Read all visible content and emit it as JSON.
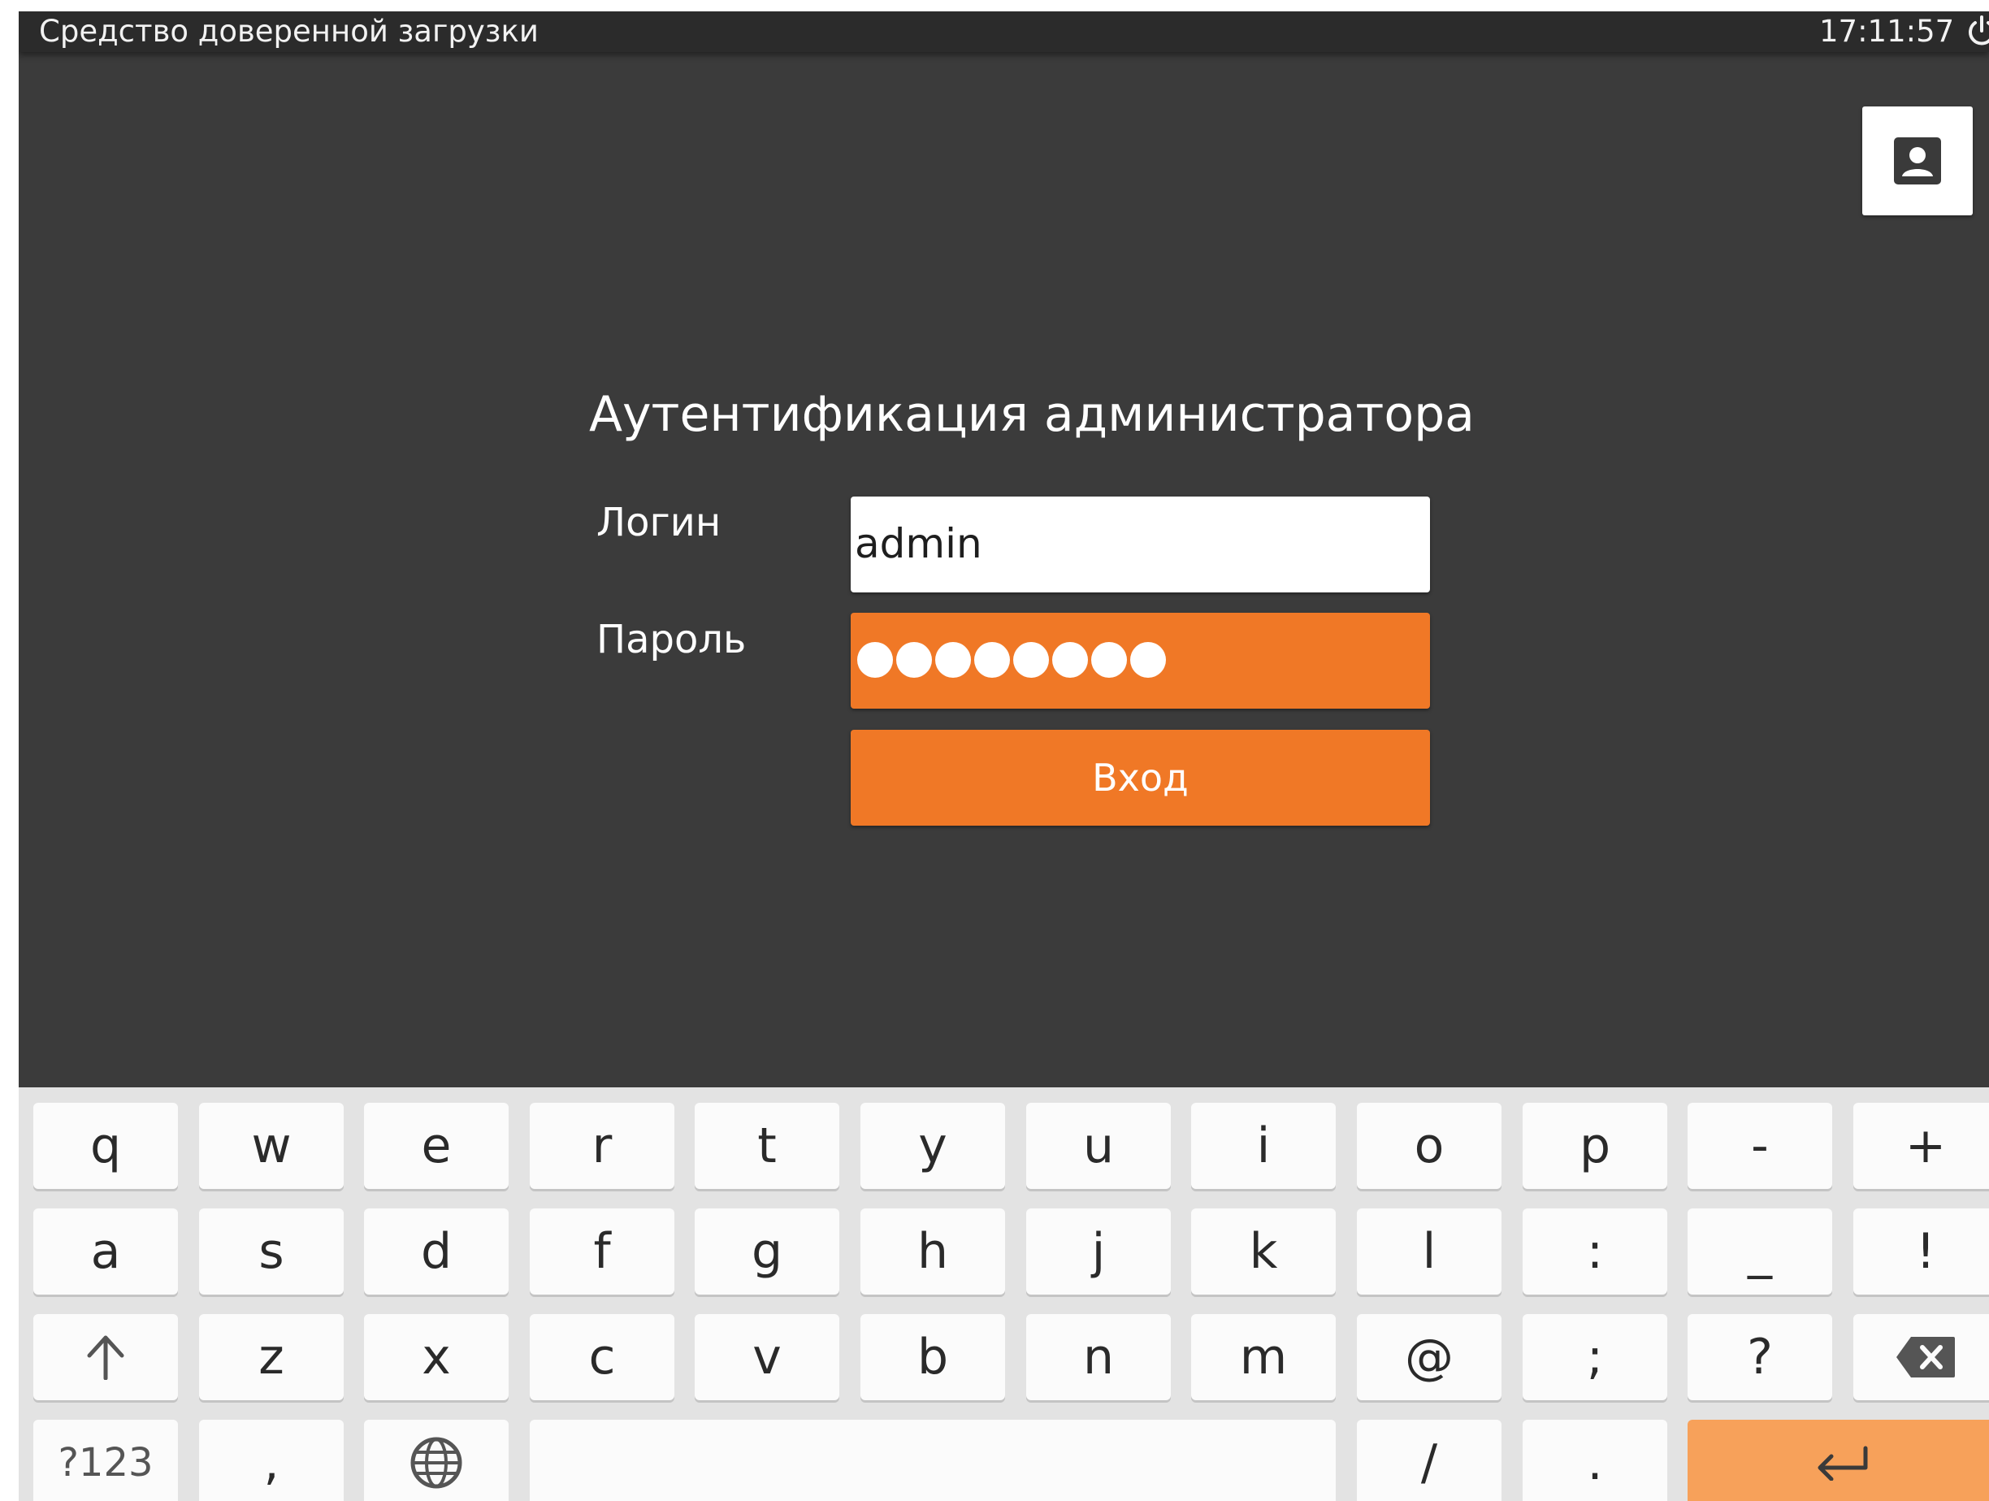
{
  "statusbar": {
    "title": "Средство доверенной загрузки",
    "time": "17:11:57",
    "power_icon": "power-icon"
  },
  "header": {
    "user_icon": "user-account-icon"
  },
  "auth": {
    "title": "Аутентификация администратора",
    "login_label": "Логин",
    "login_value": "admin",
    "password_label": "Пароль",
    "password_dots": 8,
    "submit_label": "Вход",
    "accent_color": "#f07826"
  },
  "keyboard": {
    "rows": [
      [
        "q",
        "w",
        "e",
        "r",
        "t",
        "y",
        "u",
        "i",
        "o",
        "p",
        "-",
        "+"
      ],
      [
        "a",
        "s",
        "d",
        "f",
        "g",
        "h",
        "j",
        "k",
        "l",
        ":",
        "_",
        "!"
      ],
      [
        "shift-icon",
        "z",
        "x",
        "c",
        "v",
        "b",
        "n",
        "m",
        "@",
        ";",
        "?",
        "backspace-icon"
      ],
      [
        "?123",
        ",",
        "globe-icon",
        "",
        "/",
        ".",
        "enter-icon"
      ]
    ],
    "bottom_row": {
      "mode_label": "?123",
      "comma": ",",
      "slash": "/",
      "period": "."
    }
  }
}
